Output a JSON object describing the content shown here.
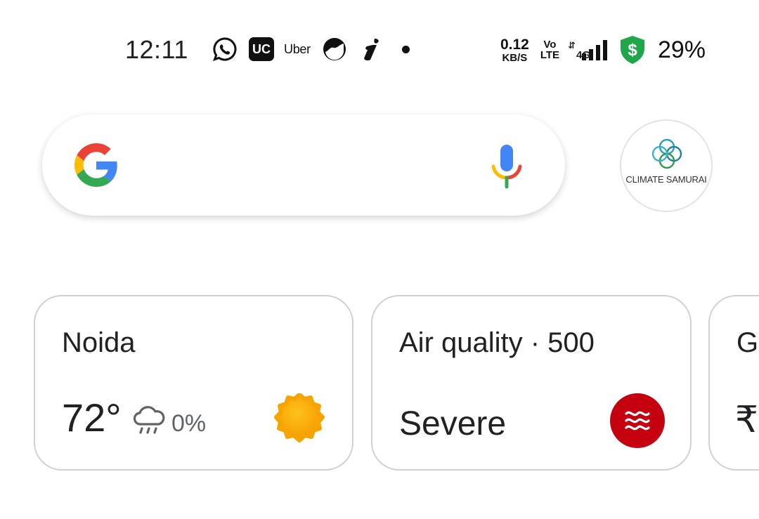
{
  "status_bar": {
    "time": "12:11",
    "notification_icons": [
      "whatsapp-icon",
      "uc-browser-icon",
      "uber-icon",
      "chart-app-icon",
      "i-app-icon",
      "more-dot"
    ],
    "uc_label": "UC",
    "uber_label": "Uber",
    "net_speed_value": "0.12",
    "net_speed_unit": "KB/S",
    "volte_top": "Vo",
    "volte_bottom": "LTE",
    "network_type": "4G",
    "battery": "29%",
    "shield_color": "#1fa64a"
  },
  "search": {
    "logo": "google-g-logo",
    "mic": "voice-search-mic"
  },
  "account": {
    "label": "CLIMATE SAMURAI"
  },
  "cards": {
    "weather": {
      "city": "Noida",
      "temperature": "72°",
      "precipitation": "0%",
      "condition_icon": "sunny-icon",
      "precip_icon": "rain-cloud-icon"
    },
    "air_quality": {
      "title": "Air quality · 500",
      "status": "Severe",
      "badge_color": "#c5000f"
    },
    "peek": {
      "title": "G",
      "value": "₹"
    }
  }
}
